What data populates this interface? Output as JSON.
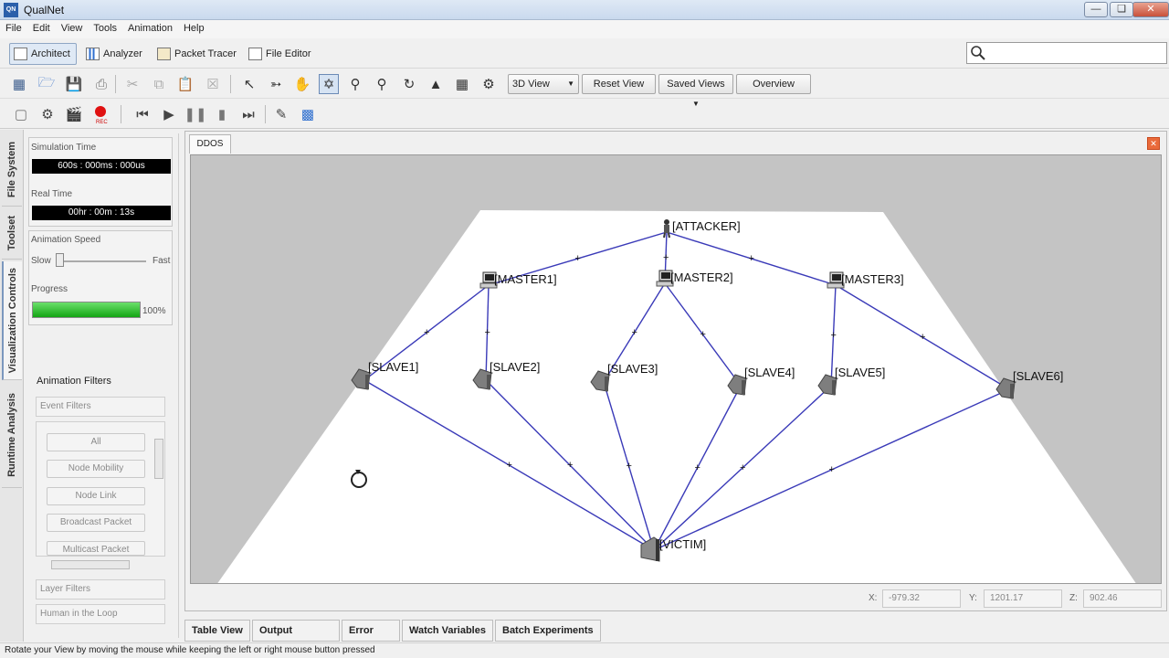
{
  "window": {
    "title": "QualNet",
    "app_icon": "QN"
  },
  "menu": [
    "File",
    "Edit",
    "View",
    "Tools",
    "Animation",
    "Help"
  ],
  "perspectives": [
    {
      "label": "Architect",
      "icon": "architect-icon",
      "active": true
    },
    {
      "label": "Analyzer",
      "icon": "chart-icon",
      "active": false
    },
    {
      "label": "Packet Tracer",
      "icon": "packet-icon",
      "active": false
    },
    {
      "label": "File Editor",
      "icon": "document-icon",
      "active": false
    }
  ],
  "search": {
    "placeholder": ""
  },
  "toolbar": {
    "view_select": "3D View",
    "reset_view": "Reset View",
    "saved_views": "Saved Views",
    "overview": "Overview"
  },
  "vertical_tabs": [
    "File System",
    "Toolset",
    "Visualization Controls",
    "Runtime Analysis"
  ],
  "left_panel": {
    "sim_time_label": "Simulation Time",
    "sim_time_value": "600s : 000ms : 000us",
    "real_time_label": "Real Time",
    "real_time_value": "00hr : 00m : 13s",
    "anim_speed_label": "Animation Speed",
    "slow": "Slow",
    "fast": "Fast",
    "progress_label": "Progress",
    "progress_value": "100%",
    "progress_fraction": 1.0,
    "filters_title": "Animation Filters",
    "event_filters": "Event Filters",
    "filter_buttons": [
      "All",
      "Node Mobility",
      "Node Link",
      "Broadcast Packet",
      "Multicast Packet"
    ],
    "layer_filters": "Layer Filters",
    "human_in_loop": "Human in the Loop"
  },
  "document": {
    "tab": "DDOS"
  },
  "nodes": [
    {
      "id": "attacker",
      "label": "[ATTACKER]"
    },
    {
      "id": "master1",
      "label": "[MASTER1]"
    },
    {
      "id": "master2",
      "label": "[MASTER2]"
    },
    {
      "id": "master3",
      "label": "[MASTER3]"
    },
    {
      "id": "slave1",
      "label": "[SLAVE1]"
    },
    {
      "id": "slave2",
      "label": "[SLAVE2]"
    },
    {
      "id": "slave3",
      "label": "[SLAVE3]"
    },
    {
      "id": "slave4",
      "label": "[SLAVE4]"
    },
    {
      "id": "slave5",
      "label": "[SLAVE5]"
    },
    {
      "id": "slave6",
      "label": "[SLAVE6]"
    },
    {
      "id": "victim",
      "label": "[VICTIM]"
    }
  ],
  "links": [
    [
      "attacker",
      "master1"
    ],
    [
      "attacker",
      "master2"
    ],
    [
      "attacker",
      "master3"
    ],
    [
      "master1",
      "slave1"
    ],
    [
      "master1",
      "slave2"
    ],
    [
      "master2",
      "slave3"
    ],
    [
      "master2",
      "slave4"
    ],
    [
      "master3",
      "slave5"
    ],
    [
      "master3",
      "slave6"
    ],
    [
      "slave1",
      "victim"
    ],
    [
      "slave2",
      "victim"
    ],
    [
      "slave3",
      "victim"
    ],
    [
      "slave4",
      "victim"
    ],
    [
      "slave5",
      "victim"
    ],
    [
      "slave6",
      "victim"
    ]
  ],
  "coords": {
    "x_label": "X:",
    "x": "-979.32",
    "y_label": "Y:",
    "y": "1201.17",
    "z_label": "Z:",
    "z": "902.46"
  },
  "bottom_tabs": [
    "Table View",
    "Output Window",
    "Error Log",
    "Watch Variables",
    "Batch Experiments"
  ],
  "status": "Rotate your View by moving the mouse while keeping the left or right mouse button pressed",
  "colors": {
    "link": "#3a3ab8",
    "progress": "#22b322"
  }
}
